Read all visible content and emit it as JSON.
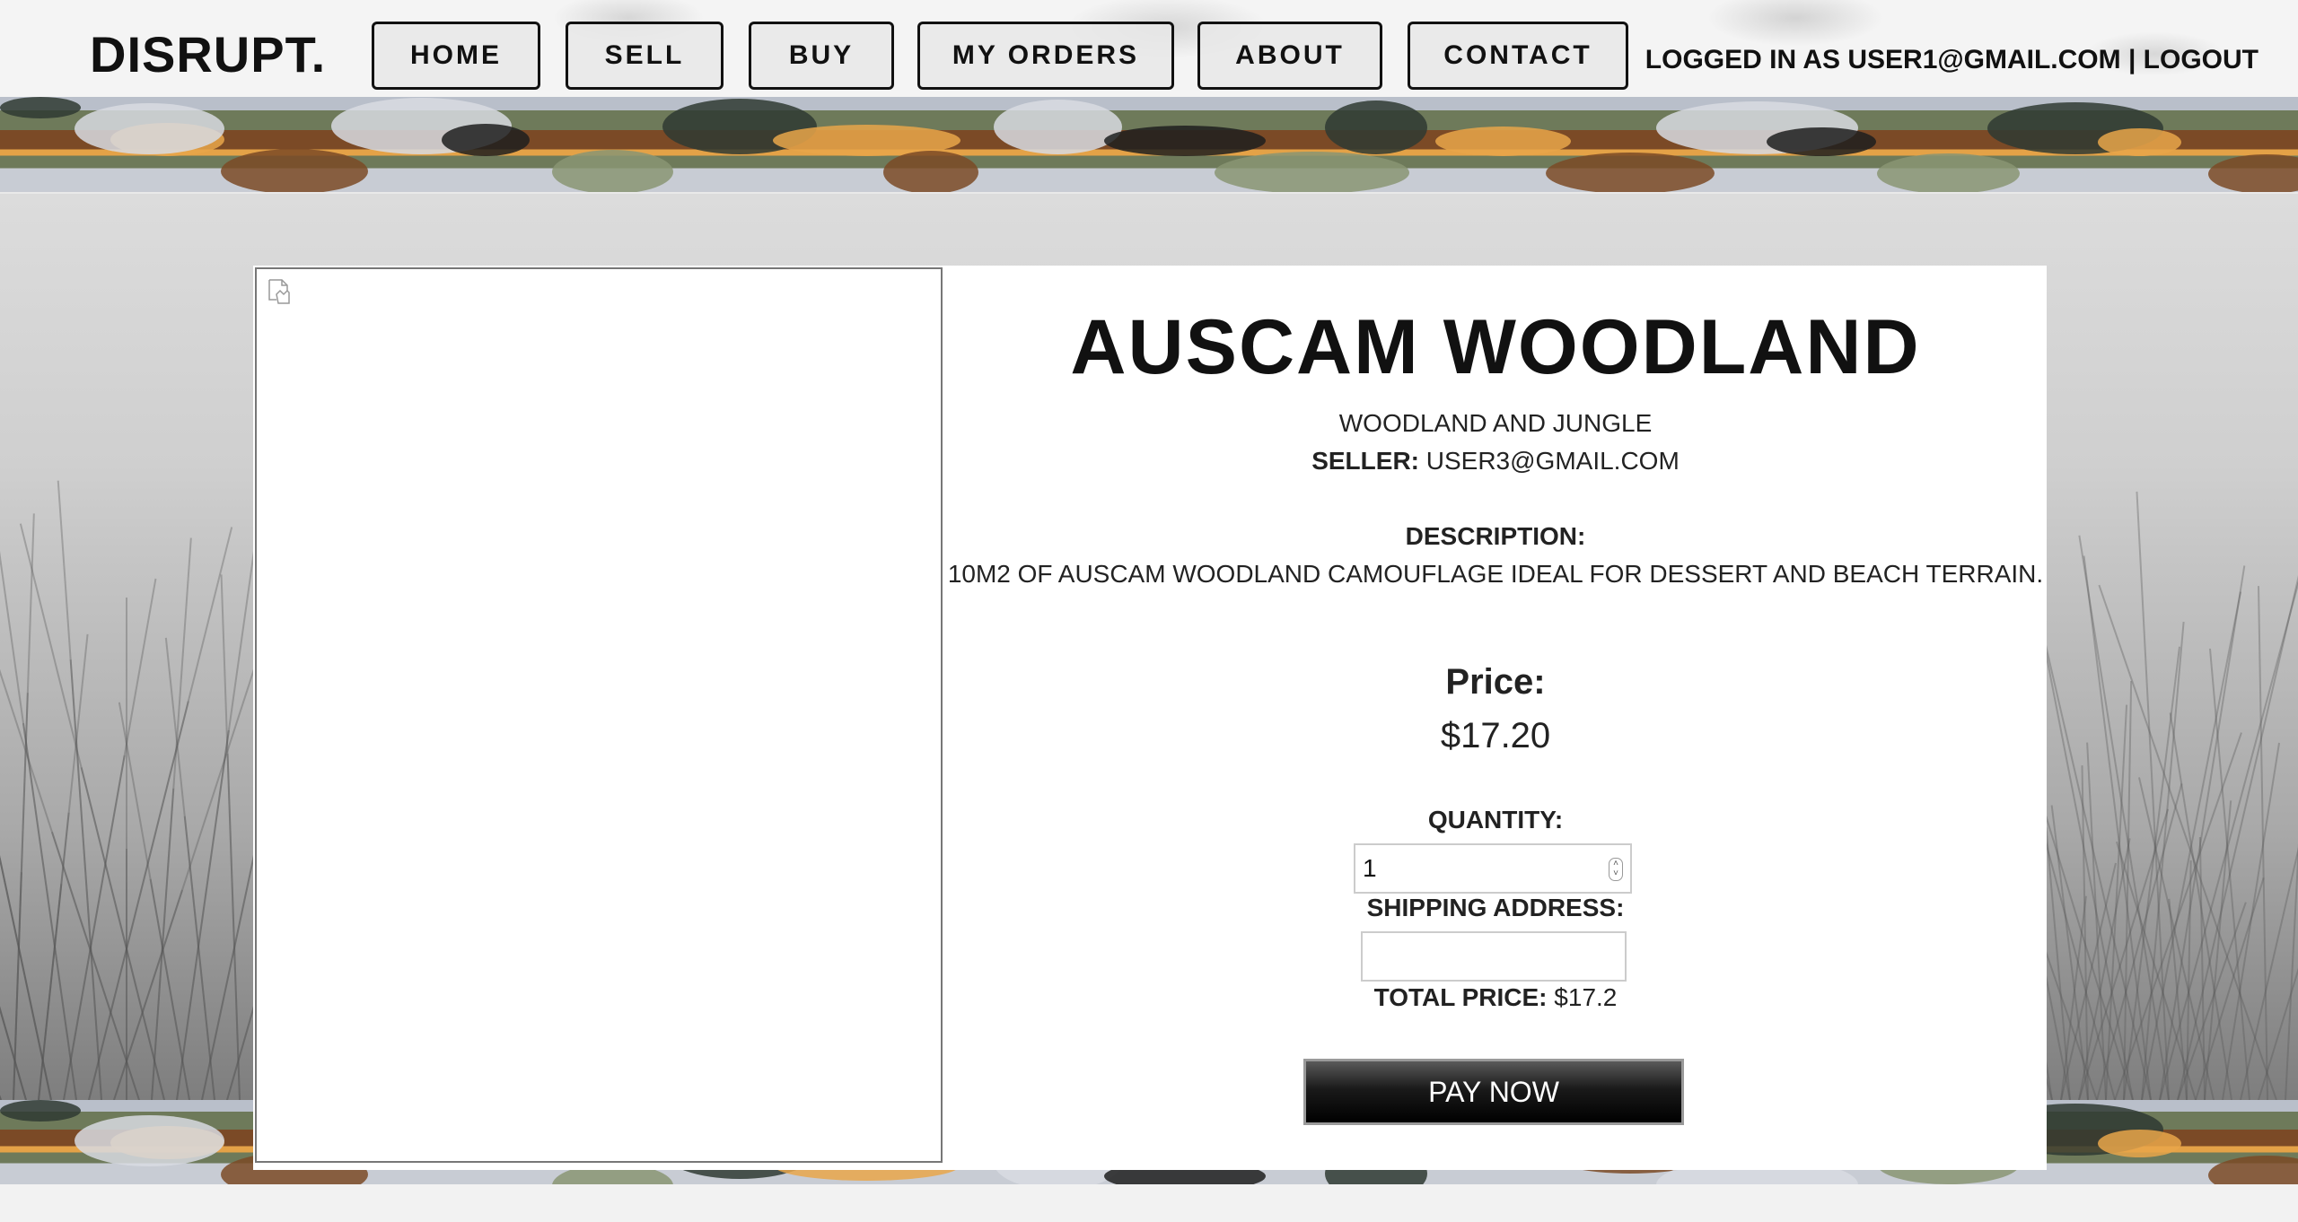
{
  "brand": {
    "logo": "DISRUPT."
  },
  "nav": {
    "items": [
      {
        "label": "HOME"
      },
      {
        "label": "SELL"
      },
      {
        "label": "BUY"
      },
      {
        "label": "MY ORDERS"
      },
      {
        "label": "ABOUT"
      },
      {
        "label": "CONTACT"
      }
    ],
    "login_status": "LOGGED IN AS USER1@GMAIL.COM | LOGOUT"
  },
  "product": {
    "title": "AUSCAM WOODLAND",
    "category": "WOODLAND AND JUNGLE",
    "seller_label": "SELLER:",
    "seller_value": "USER3@GMAIL.COM",
    "description_label": "DESCRIPTION:",
    "description": "10M2 OF AUSCAM WOODLAND CAMOUFLAGE IDEAL FOR DESSERT AND BEACH TERRAIN.",
    "price_label": "Price:",
    "price_value": "$17.20"
  },
  "order_form": {
    "quantity_label": "QUANTITY:",
    "quantity_value": "1",
    "shipping_label": "SHIPPING ADDRESS:",
    "shipping_value": "",
    "total_label": "TOTAL PRICE:",
    "total_value": "$17.2",
    "pay_button": "PAY NOW"
  },
  "icons": {
    "broken_image": "broken-image-icon",
    "spinner": "number-spinner-icon"
  }
}
